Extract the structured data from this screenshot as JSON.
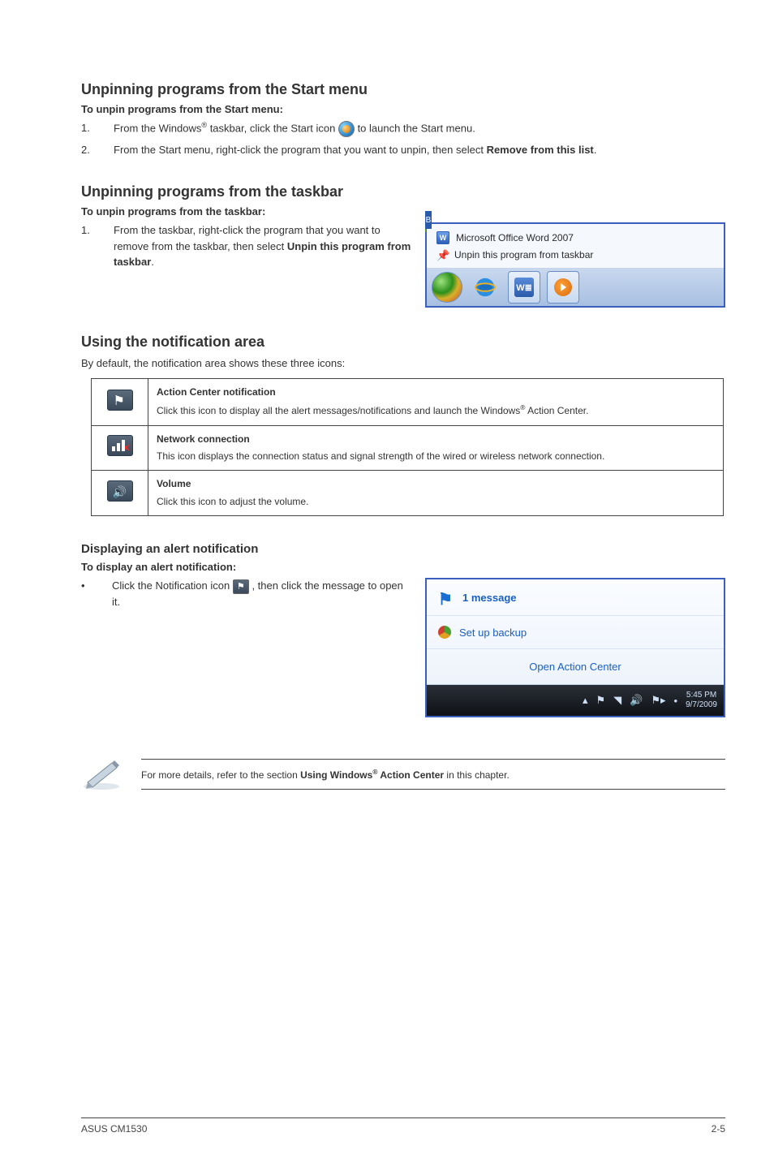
{
  "section1": {
    "title": "Unpinning programs from the Start menu",
    "sub": "To unpin programs from the Start menu:",
    "step1_a": "From the Windows",
    "step1_sup": "®",
    "step1_b": " taskbar, click the Start icon ",
    "step1_c": " to launch the Start menu.",
    "step2": "From the Start menu, right-click the program that you want to unpin, then select ",
    "step2_bold": "Remove from this list",
    "step2_end": "."
  },
  "section2": {
    "title": "Unpinning programs from the taskbar",
    "sub": "To unpin programs from the taskbar:",
    "step1_a": "From the taskbar, right-click the program that you want to remove from the taskbar, then select ",
    "step1_bold": "Unpin this program from taskbar",
    "step1_end": ".",
    "menu_item1": "Microsoft Office Word 2007",
    "menu_item2": "Unpin this program from taskbar",
    "word_glyph": "W",
    "word_glyph2": "W≣",
    "edge_b": "B"
  },
  "section3": {
    "title": "Using the notification area",
    "intro": "By default, the notification area shows these three icons:",
    "rows": [
      {
        "title": "Action Center notification",
        "desc_a": "Click this icon to display all the alert messages/notifications and launch the Windows",
        "sup": "®",
        "desc_b": " Action Center."
      },
      {
        "title": "Network connection",
        "desc_a": "This icon displays the connection status and signal strength of the wired or wireless network connection.",
        "sup": "",
        "desc_b": ""
      },
      {
        "title": "Volume",
        "desc_a": "Click this icon to adjust the volume.",
        "sup": "",
        "desc_b": ""
      }
    ]
  },
  "section4": {
    "title": "Displaying an alert notification",
    "sub": "To display an alert notification:",
    "bullet_a": "Click the Notification icon ",
    "bullet_b": ", then click the message to open it.",
    "alert": {
      "msg": "1 message",
      "backup": "Set up backup",
      "center": "Open Action Center",
      "time": "5:45 PM",
      "date": "9/7/2009"
    }
  },
  "note": {
    "a": "For more details, refer to the section ",
    "b1": "Using Windows",
    "sup": "®",
    "b2": " Action Center",
    "c": " in this chapter."
  },
  "footer": {
    "left": "ASUS CM1530",
    "right": "2-5"
  },
  "nums": {
    "one": "1.",
    "two": "2."
  },
  "bullet": "•"
}
